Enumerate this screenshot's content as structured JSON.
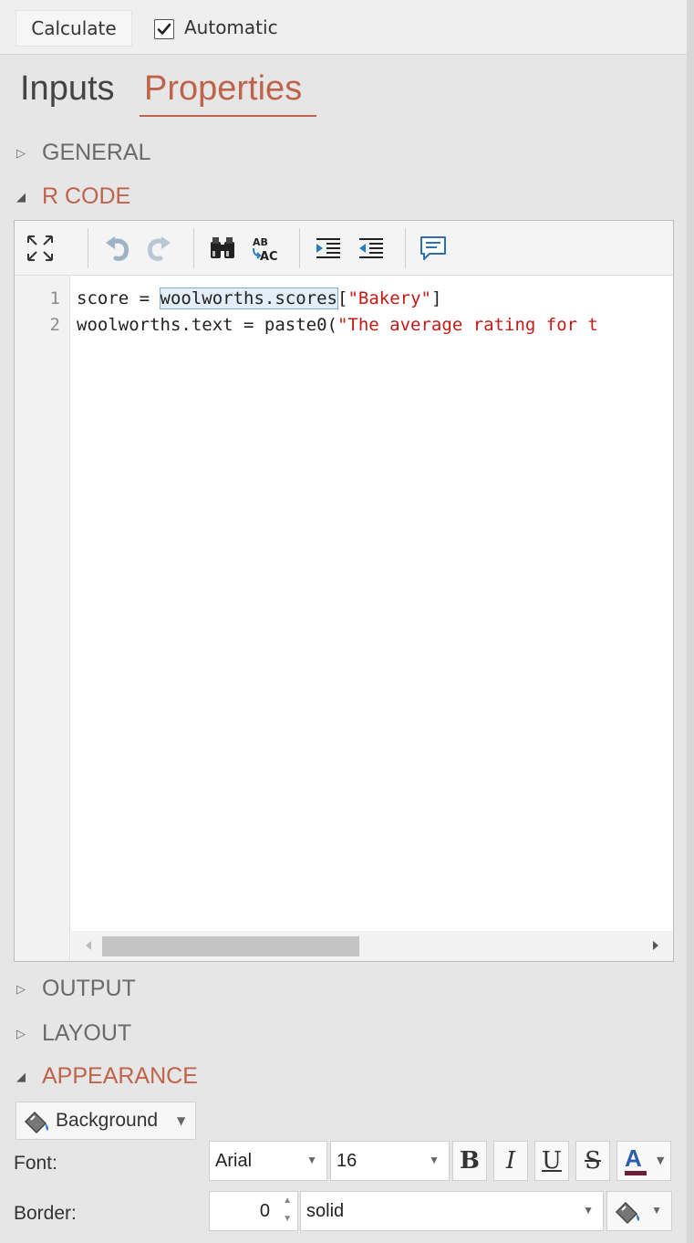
{
  "topbar": {
    "calculate_label": "Calculate",
    "automatic_label": "Automatic",
    "automatic_checked": true
  },
  "tabs": [
    {
      "label": "Inputs",
      "active": false
    },
    {
      "label": "Properties",
      "active": true
    }
  ],
  "sections": {
    "general": {
      "label": "GENERAL",
      "expanded": false
    },
    "rcode": {
      "label": "R CODE",
      "expanded": true
    },
    "output": {
      "label": "OUTPUT",
      "expanded": false
    },
    "layout": {
      "label": "LAYOUT",
      "expanded": false
    },
    "appearance": {
      "label": "APPEARANCE",
      "expanded": true
    }
  },
  "editor": {
    "toolbar_icons": [
      "expand-icon",
      "undo-icon",
      "redo-icon",
      "find-icon",
      "spellcheck-icon",
      "indent-icon",
      "outdent-icon",
      "comment-icon"
    ],
    "lines": [
      {
        "number": "1",
        "pre": "score = ",
        "highlight": "woolworths.scores",
        "post_plain": "[",
        "post_string": "\"Bakery\"",
        "post_end": "]"
      },
      {
        "number": "2",
        "plain": "woolworths.text = paste0(",
        "string": "\"The average rating for t"
      }
    ]
  },
  "appearance": {
    "background_label": "Background",
    "font_label": "Font:",
    "font_family_value": "Arial",
    "font_size_value": "16",
    "bold_label": "B",
    "italic_label": "I",
    "underline_label": "U",
    "strike_label": "S",
    "font_color_label": "A",
    "font_color": "#6b1f3a",
    "border_label": "Border:",
    "border_width_value": "0",
    "border_style_value": "solid"
  },
  "colors": {
    "accent": "#c0634b",
    "string": "#c41a16",
    "highlight_border": "#7fa9d6"
  }
}
